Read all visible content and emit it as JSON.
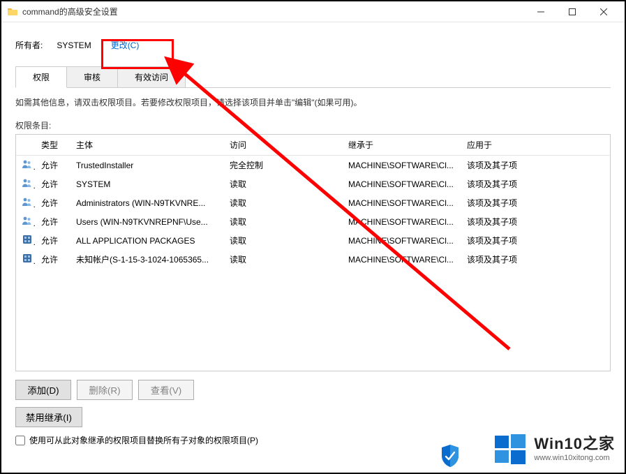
{
  "titlebar": {
    "title": "command的高级安全设置"
  },
  "owner": {
    "label": "所有者:",
    "value": "SYSTEM",
    "change": "更改(C)"
  },
  "tabs": {
    "perm": "权限",
    "audit": "审核",
    "effective": "有效访问"
  },
  "instructions": "如需其他信息，请双击权限项目。若要修改权限项目，请选择该项目并单击\"编辑\"(如果可用)。",
  "entries_label": "权限条目:",
  "columns": {
    "type": "类型",
    "principal": "主体",
    "access": "访问",
    "inherit": "继承于",
    "apply": "应用于"
  },
  "rows": [
    {
      "icon": "group",
      "type": "允许",
      "principal": "TrustedInstaller",
      "access": "完全控制",
      "inherit": "MACHINE\\SOFTWARE\\Cl...",
      "apply": "该项及其子项"
    },
    {
      "icon": "group",
      "type": "允许",
      "principal": "SYSTEM",
      "access": "读取",
      "inherit": "MACHINE\\SOFTWARE\\Cl...",
      "apply": "该项及其子项"
    },
    {
      "icon": "group",
      "type": "允许",
      "principal": "Administrators (WIN-N9TKVNRE...",
      "access": "读取",
      "inherit": "MACHINE\\SOFTWARE\\Cl...",
      "apply": "该项及其子项"
    },
    {
      "icon": "group",
      "type": "允许",
      "principal": "Users (WIN-N9TKVNREPNF\\Use...",
      "access": "读取",
      "inherit": "MACHINE\\SOFTWARE\\Cl...",
      "apply": "该项及其子项"
    },
    {
      "icon": "package",
      "type": "允许",
      "principal": "ALL APPLICATION PACKAGES",
      "access": "读取",
      "inherit": "MACHINE\\SOFTWARE\\Cl...",
      "apply": "该项及其子项"
    },
    {
      "icon": "package",
      "type": "允许",
      "principal": "未知帐户(S-1-15-3-1024-1065365...",
      "access": "读取",
      "inherit": "MACHINE\\SOFTWARE\\Cl...",
      "apply": "该项及其子项"
    }
  ],
  "buttons": {
    "add": "添加(D)",
    "remove": "删除(R)",
    "view": "查看(V)",
    "disable_inherit": "禁用继承(I)"
  },
  "replace": {
    "label": "使用可从此对象继承的权限项目替换所有子对象的权限项目(P)"
  },
  "watermark": {
    "title": "Win10之家",
    "url": "www.win10xitong.com"
  }
}
